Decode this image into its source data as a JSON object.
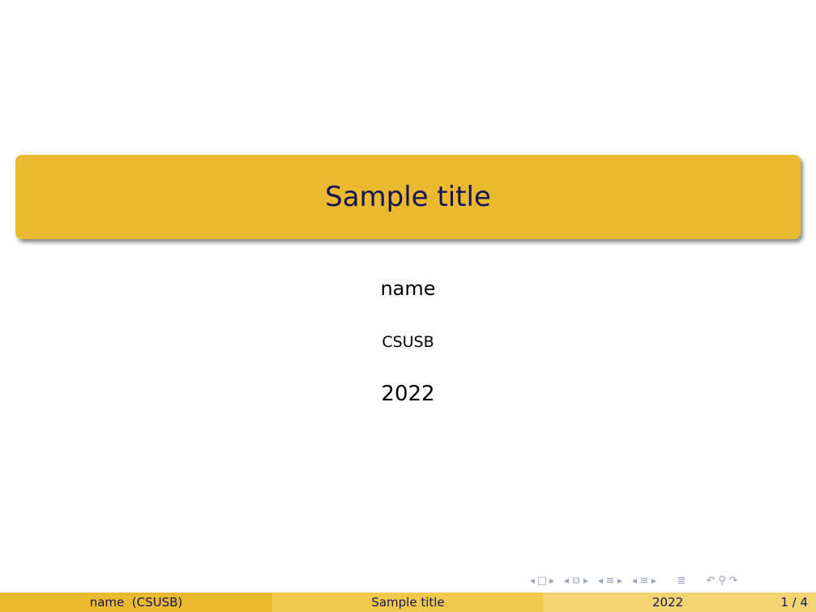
{
  "slide": {
    "title": "Sample title",
    "author": "name",
    "institute": "CSUSB",
    "date": "2022"
  },
  "footer": {
    "author_institute": "name  (CSUSB)",
    "title": "Sample title",
    "date": "2022",
    "page": "1 / 4"
  },
  "nav": {
    "icons": [
      "slide-prev-icon",
      "slide-icon",
      "slide-next-icon",
      "frame-prev-icon",
      "frame-icon",
      "frame-next-icon",
      "subsection-prev-icon",
      "subsection-icon",
      "subsection-next-icon",
      "section-prev-icon",
      "section-icon",
      "section-next-icon",
      "toc-icon",
      "undo-icon",
      "search-icon",
      "redo-icon"
    ]
  },
  "colors": {
    "title_box": "#ebb92d",
    "title_text": "#14145a",
    "footer_left": "#ebb92d",
    "footer_mid": "#f0c94a",
    "footer_right": "#f3d472"
  }
}
